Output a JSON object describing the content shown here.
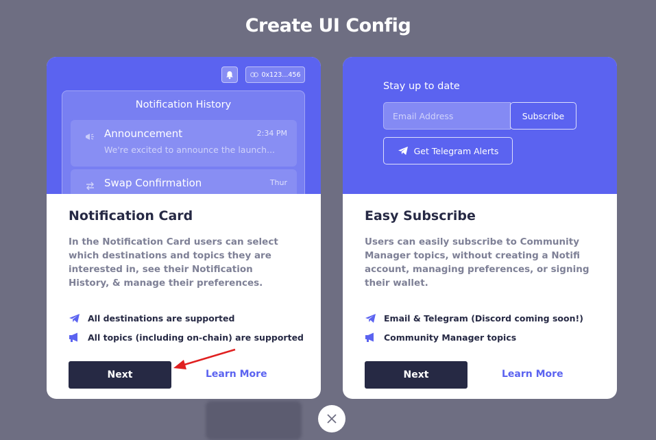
{
  "modal": {
    "title": "Create UI Config",
    "close_icon": "close-icon"
  },
  "cards": [
    {
      "title": "Notification Card",
      "description": "In the Notification Card users can select which destinations and topics they are interested in, see their Notification History, & manage their preferences.",
      "features": [
        {
          "icon": "telegram-icon",
          "label": "All destinations are supported"
        },
        {
          "icon": "megaphone-icon",
          "label": "All topics (including on-chain) are supported"
        }
      ],
      "next_label": "Next",
      "learn_more_label": "Learn More",
      "preview": {
        "wallet_address": "0x123...456",
        "history_title": "Notification History",
        "items": [
          {
            "icon": "megaphone-icon",
            "name": "Announcement",
            "time": "2:34 PM",
            "body": "We're excited to announce the launch..."
          },
          {
            "icon": "swap-icon",
            "name": "Swap Confirmation",
            "time": "Thur",
            "body": ""
          }
        ]
      }
    },
    {
      "title": "Easy Subscribe",
      "description": "Users can easily subscribe to Community Manager topics, without creating a Notifi account, managing preferences, or signing their wallet.",
      "features": [
        {
          "icon": "telegram-icon",
          "label": "Email & Telegram (Discord coming soon!)"
        },
        {
          "icon": "megaphone-icon",
          "label": "Community Manager topics"
        }
      ],
      "next_label": "Next",
      "learn_more_label": "Learn More",
      "preview": {
        "heading": "Stay up to date",
        "email_placeholder": "Email Address",
        "subscribe_label": "Subscribe",
        "telegram_label": "Get Telegram Alerts"
      }
    }
  ],
  "colors": {
    "accent": "#5b63f0",
    "dark_button": "#262944",
    "overlay": "#6e6e82",
    "annotation_arrow": "#e02020"
  }
}
